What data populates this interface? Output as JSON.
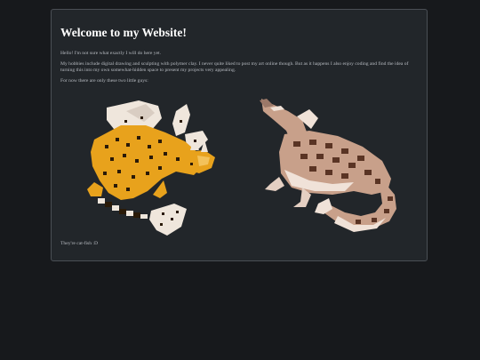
{
  "page": {
    "heading": "Welcome to my Website!",
    "intro": "Hello! I'm not sure what exactly I will do here yet.",
    "hobbies": "My hobbies include digital drawing and sculpting with polymer clay. I never quite liked to post my art online though. But as it happens I also enjoy coding and find the idea of turning this into my own somewhat-hidden space to present my projects very appealing.",
    "lead_in": "For now there are only these two little guys:",
    "caption": "They're cat-fish :D"
  },
  "images": [
    {
      "name": "yellow-spotted-cat-fish-pixel-art",
      "colors": {
        "body": "#e8a21c",
        "spots": "#2a1a08",
        "fins": "#efe6dc"
      }
    },
    {
      "name": "tan-spotted-cat-fish-pixel-art",
      "colors": {
        "body": "#c8a08a",
        "spots": "#5a3424",
        "belly": "#f0e2d8"
      }
    }
  ]
}
